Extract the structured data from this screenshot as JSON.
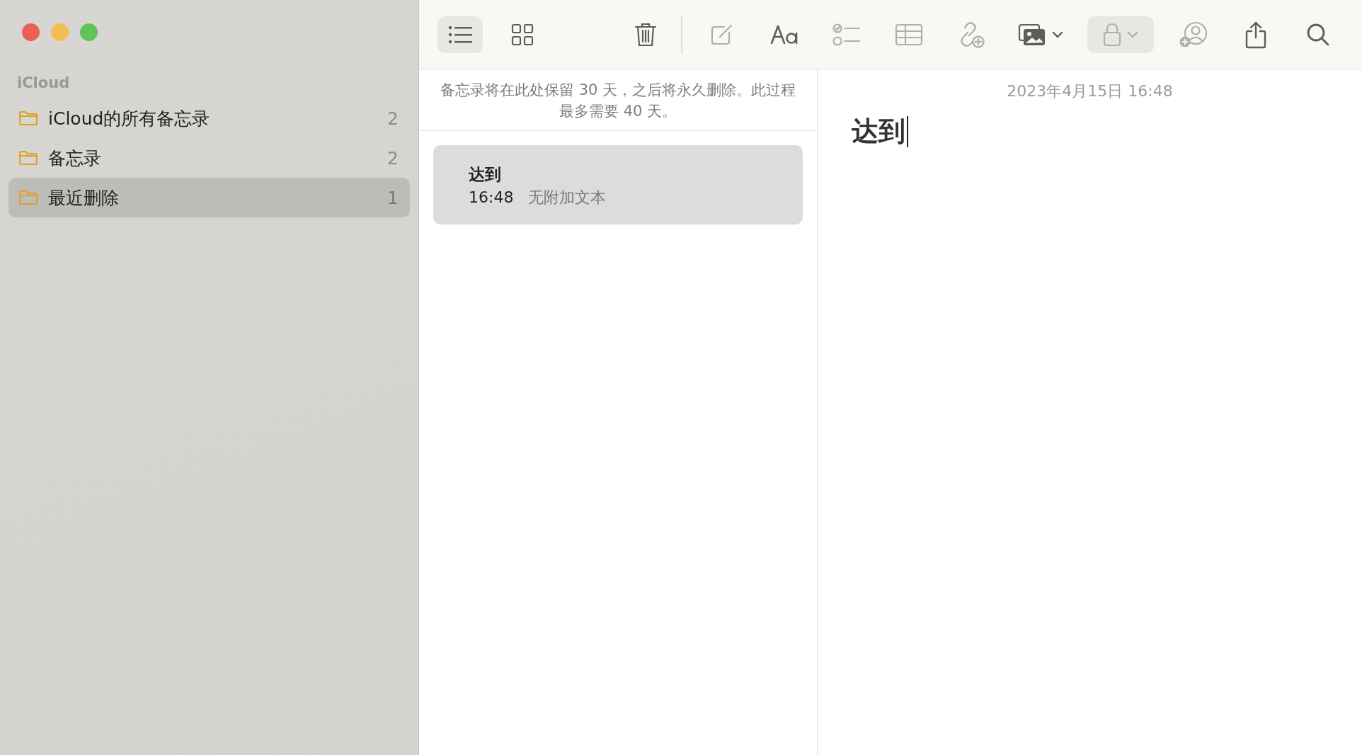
{
  "sidebar": {
    "section_title": "iCloud",
    "folders": [
      {
        "name": "iCloud的所有备忘录",
        "count": "2",
        "selected": false
      },
      {
        "name": "备忘录",
        "count": "2",
        "selected": false
      },
      {
        "name": "最近删除",
        "count": "1",
        "selected": true
      }
    ]
  },
  "toolbar": {
    "tools": [
      {
        "kind": "list-view",
        "selected": true,
        "disabled": false
      },
      {
        "kind": "gallery-view",
        "selected": false,
        "disabled": false
      },
      {
        "kind": "delete",
        "selected": false,
        "disabled": false
      },
      {
        "kind": "compose",
        "selected": false,
        "disabled": true
      },
      {
        "kind": "format",
        "selected": false,
        "disabled": false
      },
      {
        "kind": "checklist",
        "selected": false,
        "disabled": true
      },
      {
        "kind": "table",
        "selected": false,
        "disabled": true
      },
      {
        "kind": "link",
        "selected": false,
        "disabled": true
      },
      {
        "kind": "media",
        "selected": false,
        "disabled": false
      },
      {
        "kind": "lock",
        "selected": true,
        "disabled": true
      },
      {
        "kind": "collaborate",
        "selected": false,
        "disabled": true
      },
      {
        "kind": "share",
        "selected": false,
        "disabled": false
      },
      {
        "kind": "search",
        "selected": false,
        "disabled": false
      }
    ]
  },
  "note_list": {
    "notice": "备忘录将在此处保留 30 天，之后将永久删除。此过程最多需要 40 天。",
    "notes": [
      {
        "title": "达到",
        "time": "16:48",
        "preview": "无附加文本",
        "selected": true
      }
    ]
  },
  "editor": {
    "date": "2023年4月15日 16:48",
    "title": "达到",
    "caret": true
  }
}
